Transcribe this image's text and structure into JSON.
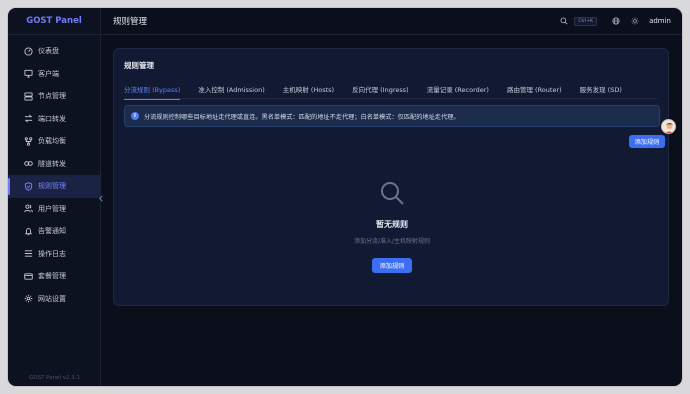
{
  "app": {
    "brand": "GOST Panel",
    "version": "GOST Panel v2.3.1"
  },
  "sidebar": {
    "items": [
      {
        "label": "仪表盘",
        "icon": "dashboard-icon",
        "active": false
      },
      {
        "label": "客户端",
        "icon": "monitor-icon",
        "active": false
      },
      {
        "label": "节点管理",
        "icon": "server-icon",
        "active": false
      },
      {
        "label": "端口转发",
        "icon": "forward-icon",
        "active": false
      },
      {
        "label": "负载均衡",
        "icon": "branch-icon",
        "active": false
      },
      {
        "label": "隧道转发",
        "icon": "link-icon",
        "active": false
      },
      {
        "label": "规则管理",
        "icon": "shield-icon",
        "active": true
      },
      {
        "label": "用户管理",
        "icon": "users-icon",
        "active": false
      },
      {
        "label": "告警通知",
        "icon": "bell-icon",
        "active": false
      },
      {
        "label": "操作日志",
        "icon": "list-icon",
        "active": false
      },
      {
        "label": "套餐管理",
        "icon": "card-icon",
        "active": false
      },
      {
        "label": "网站设置",
        "icon": "gear-icon",
        "active": false
      }
    ]
  },
  "header": {
    "title": "规则管理",
    "shortcut": "Ctrl+K",
    "user": "admin"
  },
  "card": {
    "title": "规则管理",
    "tabs": [
      {
        "label": "分流规则 (Bypass)",
        "active": true
      },
      {
        "label": "准入控制 (Admission)",
        "active": false
      },
      {
        "label": "主机映射 (Hosts)",
        "active": false
      },
      {
        "label": "反向代理 (Ingress)",
        "active": false
      },
      {
        "label": "流量记录 (Recorder)",
        "active": false
      },
      {
        "label": "路由管理 (Router)",
        "active": false
      },
      {
        "label": "服务发现 (SD)",
        "active": false
      }
    ],
    "alert": "分流规则控制哪些目标地址走代理或直连。黑名单模式：匹配的地址不走代理；白名单模式：仅匹配的地址走代理。",
    "add_button": "添加规则",
    "empty": {
      "title": "暂无规则",
      "description": "添加分流/准入/主机映射规则",
      "button": "添加规则"
    }
  },
  "colors": {
    "accent": "#6f7bf7",
    "primary_button": "#3b6ef0",
    "active_tab": "#5b86f5",
    "background": "#0b0f1c",
    "card": "#121932"
  }
}
